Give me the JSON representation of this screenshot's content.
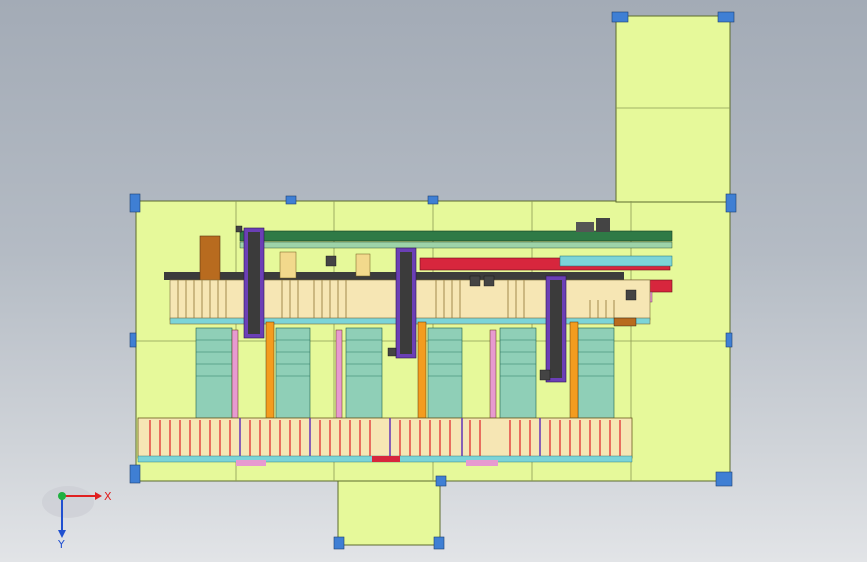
{
  "view": {
    "background_top": "#a3abb6",
    "background_bottom": "#e2e4e7"
  },
  "colors": {
    "floor": "#e6f99a",
    "floor_line": "#5c6b2e",
    "conveyor_rail": "#2f7a46",
    "rack_stripe": "#e23a3a",
    "frame_orange": "#f39c1f",
    "frame_pink": "#e79ad0",
    "frame_cyan": "#33b9c7",
    "frame_purple": "#6b3fb6",
    "frame_red": "#d7263d",
    "box_brown": "#b86b1f",
    "corner_blue": "#3f7fd4"
  },
  "triad": {
    "x_label": "X",
    "y_label": "Y",
    "x_color": "#e02020",
    "y_color": "#2050d0",
    "origin_color": "#20b040"
  }
}
